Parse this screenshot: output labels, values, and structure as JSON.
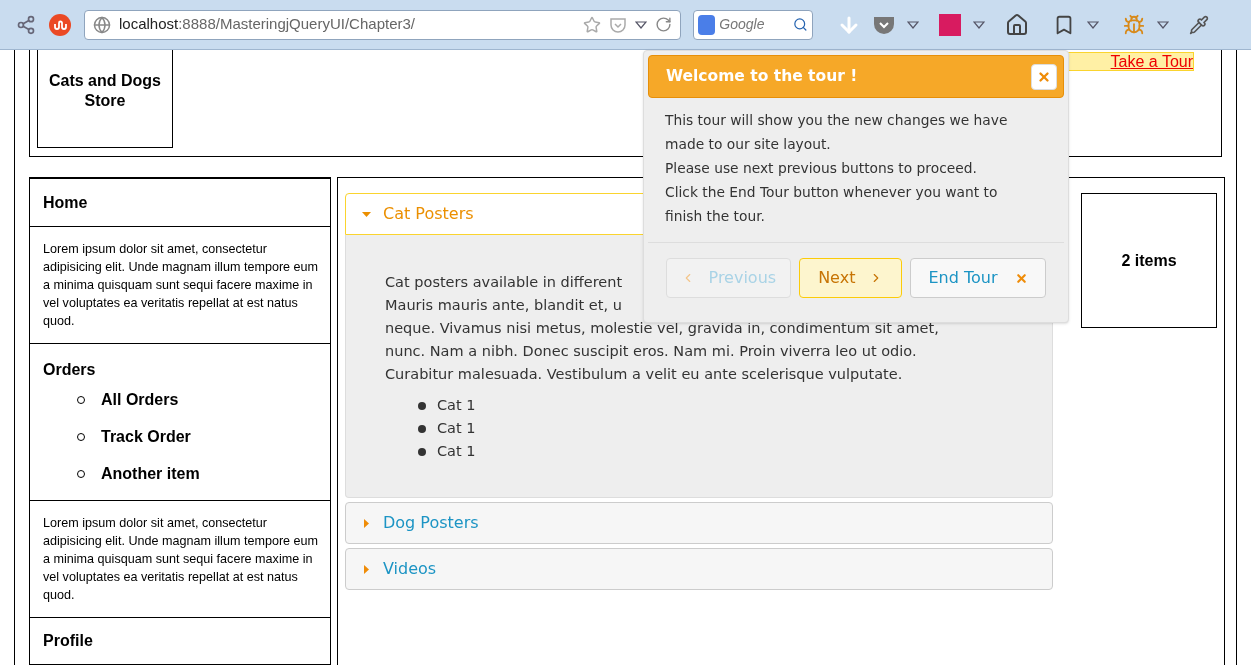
{
  "browser": {
    "url_host": "localhost",
    "url_path": ":8888/MasteringjQueryUI/Chapter3/",
    "search_placeholder": "Google"
  },
  "header": {
    "logo": "Cats and Dogs Store",
    "tour_link": "Take a Tour"
  },
  "sidebar": [
    {
      "kind": "link",
      "text": "Home"
    },
    {
      "kind": "text",
      "text": "Lorem ipsum dolor sit amet, consectetur adipisicing elit. Unde magnam illum tempore eum a minima quisquam sunt sequi facere maxime in vel voluptates ea veritatis repellat at est natus quod."
    },
    {
      "kind": "group",
      "text": "Orders",
      "children": [
        {
          "text": "All Orders"
        },
        {
          "text": "Track Order"
        },
        {
          "text": "Another item"
        }
      ]
    },
    {
      "kind": "text",
      "text": "Lorem ipsum dolor sit amet, consectetur adipisicing elit. Unde magnam illum tempore eum a minima quisquam sunt sequi facere maxime in vel voluptates ea veritatis repellat at est natus quod."
    },
    {
      "kind": "link",
      "text": "Profile"
    }
  ],
  "accordion": [
    {
      "title": "Cat Posters",
      "expanded": true,
      "lines": [
        "Cat posters available in different",
        "Mauris mauris ante, blandit et, u",
        "neque. Vivamus nisi metus, molestie vel, gravida in, condimentum sit amet,",
        "nunc. Nam a nibh. Donec suscipit eros. Nam mi. Proin viverra leo ut odio.",
        "Curabitur malesuada. Vestibulum a velit eu ante scelerisque vulputate."
      ],
      "items": [
        "Cat 1",
        "Cat 1",
        "Cat 1"
      ]
    },
    {
      "title": "Dog Posters",
      "expanded": false
    },
    {
      "title": "Videos",
      "expanded": false
    }
  ],
  "cart": {
    "label": "2 items"
  },
  "tour": {
    "title": "Welcome to the tour !",
    "body": [
      "This tour will show you the new changes we have",
      "made to our site layout.",
      "Please use next previous buttons to proceed.",
      "Click the End Tour button whenever you want to",
      "finish the tour."
    ],
    "buttons": [
      {
        "kind": "previous",
        "label": "Previous",
        "disabled": true
      },
      {
        "kind": "next",
        "label": "Next",
        "disabled": false
      },
      {
        "kind": "end",
        "label": "End Tour",
        "disabled": false
      }
    ]
  }
}
